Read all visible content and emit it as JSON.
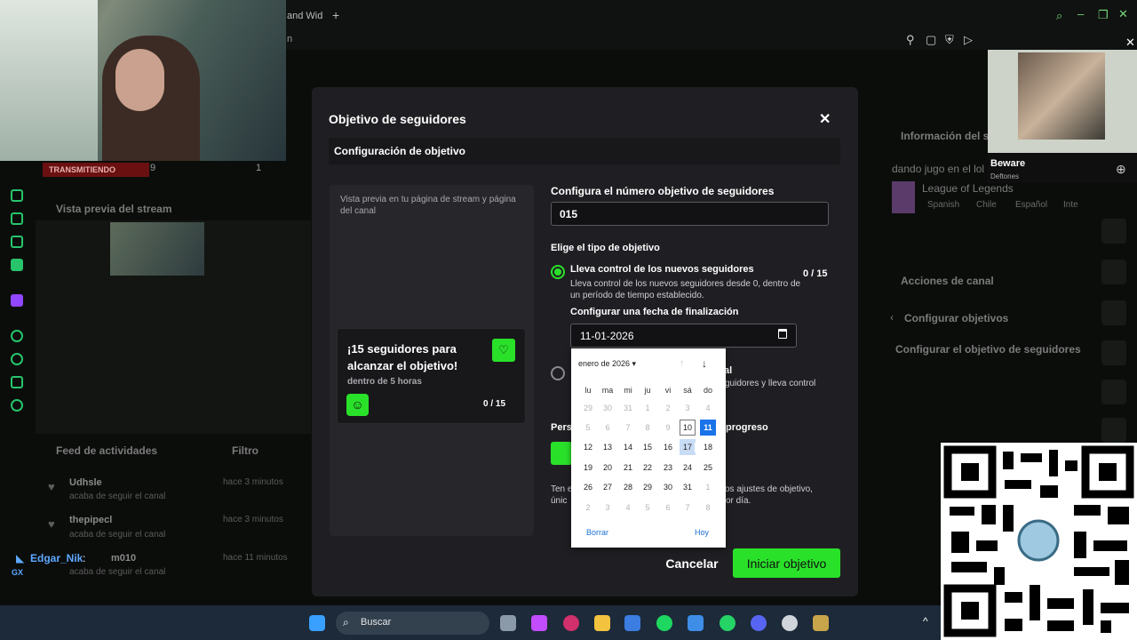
{
  "top_bar": {
    "tab_title": "and Wid",
    "tab_plus": "+",
    "subtitle": "n"
  },
  "stream_manager": {
    "live_badge": "TRANSMITIENDO",
    "viewers_count": "9",
    "followers_count": "1",
    "preview_title": "Vista previa del stream",
    "activity_feed_title": "Feed de actividades",
    "activity_feed_filter": "Filtro",
    "feed": [
      {
        "name": "Udhsle",
        "action": "acaba de seguir el canal",
        "time": "hace 3 minutos"
      },
      {
        "name": "thepipecl",
        "action": "acaba de seguir el canal",
        "time": "hace 3 minutos"
      },
      {
        "name": "m010",
        "action": "acaba de seguir el canal",
        "time": "hace 11 minutos"
      }
    ],
    "chat_user": "Edgar_Nik",
    "chat_sep": ":",
    "chat_badge": "GX"
  },
  "right_panel": {
    "info_title": "Información del st",
    "stream_title": "dando jugo en el lol",
    "game": "League of Legends",
    "tags": [
      "Spanish",
      "Chile",
      "Español",
      "Inte"
    ],
    "actions_title": "Acciones de canal",
    "config_goals": "Configurar objetivos",
    "config_follower_goal": "Configurar el objetivo de seguidores"
  },
  "music_widget": {
    "title": "Beware",
    "artist": "Deftones",
    "close": "✕"
  },
  "dialog": {
    "title": "Objetivo de seguidores",
    "close": "✕",
    "section_title": "Configuración de objetivo",
    "preview_description": "Vista previa en tu página de stream y página del canal",
    "preview_card": {
      "title": "¡15 seguidores para alcanzar el objetivo!",
      "subtitle": "dentro de 5 horas",
      "progress": "0 / 15"
    },
    "number_label": "Configura el número objetivo de seguidores",
    "number_value": "015",
    "type_label": "Elige el tipo de objetivo",
    "option_new": {
      "title": "Lleva control de los nuevos seguidores",
      "description": "Lleva control de los nuevos seguidores desde 0, dentro de un período de tiempo establecido.",
      "progress": "0 / 15",
      "end_date_label": "Configurar una fecha de finalización",
      "end_date_value": "11-01-2026"
    },
    "option_total": {
      "title_fragment": "al",
      "description_fragment": "guidores y lleva control"
    },
    "customize_label": "Pers",
    "customize_label_tail": "progreso",
    "note_line1": "Ten e",
    "note_line1_tail": "os ajustes de objetivo,",
    "note_line2": "únic",
    "note_line2_tail": "or día.",
    "cancel": "Cancelar",
    "start": "Iniciar objetivo"
  },
  "calendar": {
    "month_label": "enero de 2026 ▾",
    "weekdays": [
      "lu",
      "ma",
      "mi",
      "ju",
      "vi",
      "sá",
      "do"
    ],
    "weeks": [
      [
        "29",
        "30",
        "31",
        "1",
        "2",
        "3",
        "4"
      ],
      [
        "5",
        "6",
        "7",
        "8",
        "9",
        "10",
        "11"
      ],
      [
        "12",
        "13",
        "14",
        "15",
        "16",
        "17",
        "18"
      ],
      [
        "19",
        "20",
        "21",
        "22",
        "23",
        "24",
        "25"
      ],
      [
        "26",
        "27",
        "28",
        "29",
        "30",
        "31",
        "1"
      ],
      [
        "2",
        "3",
        "4",
        "5",
        "6",
        "7",
        "8"
      ]
    ],
    "clear": "Borrar",
    "today": "Hoy"
  },
  "taskbar": {
    "search_placeholder": "Buscar"
  },
  "colors": {
    "accent_green": "#2ae12a",
    "calendar_selected": "#1a73e8",
    "dialog_bg": "#1f1f23"
  }
}
